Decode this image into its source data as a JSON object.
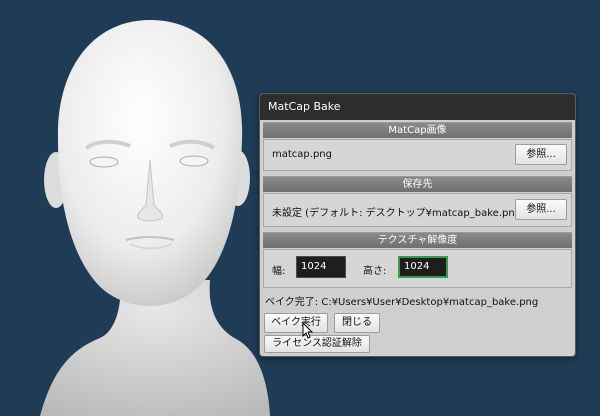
{
  "dialog": {
    "title": "MatCap Bake",
    "matcap_section": {
      "header": "MatCap画像",
      "file_name": "matcap.png",
      "browse_label": "参照..."
    },
    "output_section": {
      "header": "保存先",
      "path_text": "未設定 (デフォルト: デスクトップ¥matcap_bake.png)",
      "browse_label": "参照..."
    },
    "resolution_section": {
      "header": "テクスチャ解像度",
      "width_label": "幅:",
      "width_value": "1024",
      "height_label": "高さ:",
      "height_value": "1024"
    },
    "status_text": "ベイク完了: C:¥Users¥User¥Desktop¥matcap_bake.png",
    "bake_button": "ベイク実行",
    "close_button": "閉じる",
    "license_button": "ライセンス認証解除"
  },
  "colors": {
    "viewport_background": "#1f3b55",
    "dialog_background": "#cfcfcf",
    "titlebar": "#2d2d2d",
    "section_header": "#7a7a7a",
    "field_background": "#1e1e1e",
    "focus_border": "#3a9a4a"
  },
  "icons": {
    "cursor": "mouse-pointer-icon"
  }
}
